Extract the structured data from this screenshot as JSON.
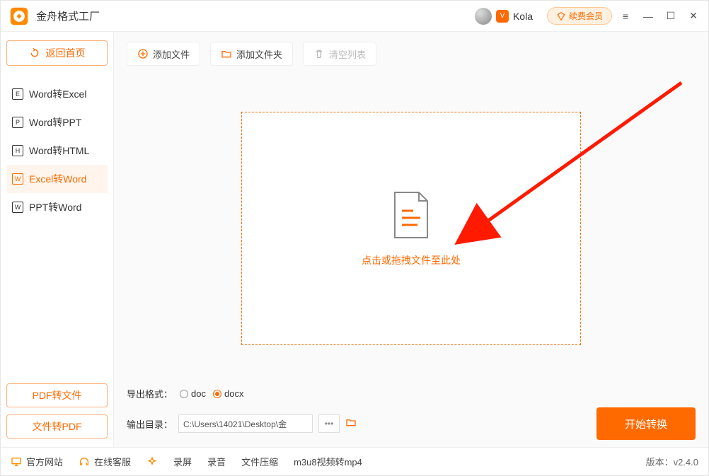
{
  "titlebar": {
    "app_title": "金舟格式工厂",
    "username": "Kola",
    "renew_label": "续费会员"
  },
  "sidebar": {
    "back_label": "返回首页",
    "items": [
      {
        "icon": "E",
        "label": "Word转Excel"
      },
      {
        "icon": "P",
        "label": "Word转PPT"
      },
      {
        "icon": "H",
        "label": "Word转HTML"
      },
      {
        "icon": "W",
        "label": "Excel转Word"
      },
      {
        "icon": "W",
        "label": "PPT转Word"
      }
    ],
    "active_index": 3,
    "pdf_to_file": "PDF转文件",
    "file_to_pdf": "文件转PDF"
  },
  "toolbar": {
    "add_file": "添加文件",
    "add_folder": "添加文件夹",
    "clear_list": "清空列表"
  },
  "dropzone": {
    "text": "点击或拖拽文件至此处"
  },
  "export": {
    "label": "导出格式：",
    "options": [
      "doc",
      "docx"
    ],
    "selected": "docx"
  },
  "output": {
    "label": "输出目录：",
    "path": "C:\\Users\\14021\\Desktop\\金"
  },
  "actions": {
    "start": "开始转换"
  },
  "statusbar": {
    "official_site": "官方网站",
    "online_service": "在线客服",
    "screen_record": "录屏",
    "audio_record": "录音",
    "file_compress": "文件压缩",
    "m3u8": "m3u8视频转mp4",
    "version_label": "版本：",
    "version": "v2.4.0"
  }
}
